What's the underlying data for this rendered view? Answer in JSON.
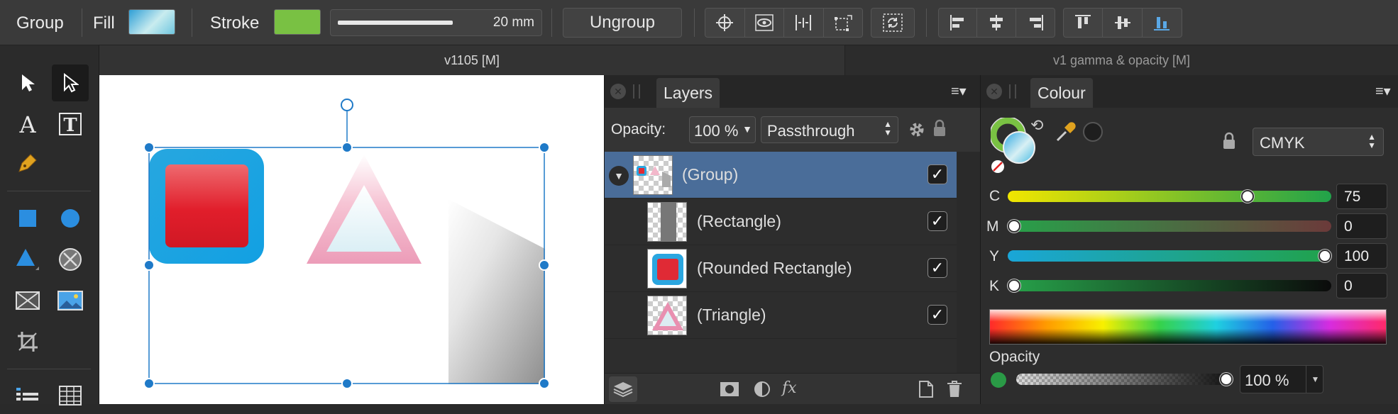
{
  "toolbar": {
    "mode_label": "Group",
    "fill_label": "Fill",
    "stroke_label": "Stroke",
    "stroke_width": "20 mm",
    "stroke_width_level": 0.4,
    "ungroup_label": "Ungroup",
    "fill_colors": [
      "#35a7d9",
      "#d5eef2"
    ],
    "stroke_color": "#79c143"
  },
  "tabs": [
    {
      "label": "v1105  [M]",
      "active": true
    },
    {
      "label": "v1 gamma & opacity [M]",
      "active": false
    }
  ],
  "tools": [
    "move-tool",
    "node-tool",
    "artistic-text-tool",
    "frame-text-tool",
    "pen-tool",
    "rectangle-tool",
    "ellipse-tool",
    "triangle-tool",
    "donut-tool",
    "picture-frame-tool",
    "image-tool",
    "crop-tool",
    "table-tool"
  ],
  "layers": {
    "tab_label": "Layers",
    "opacity_label": "Opacity:",
    "opacity_value": "100 %",
    "blend_mode": "Passthrough",
    "items": [
      {
        "name": "(Group)",
        "selected": true,
        "visible": true
      },
      {
        "name": "(Rectangle)",
        "selected": false,
        "visible": true
      },
      {
        "name": "(Rounded Rectangle)",
        "selected": false,
        "visible": true
      },
      {
        "name": "(Triangle)",
        "selected": false,
        "visible": true
      }
    ]
  },
  "colour": {
    "tab_label": "Colour",
    "model": "CMYK",
    "opacity_label": "Opacity",
    "opacity_value": "100 %",
    "channels": [
      {
        "label": "C",
        "value": "75",
        "level": 0.75
      },
      {
        "label": "M",
        "value": "0",
        "level": 0
      },
      {
        "label": "Y",
        "value": "100",
        "level": 1.0
      },
      {
        "label": "K",
        "value": "0",
        "level": 0
      }
    ],
    "accent": "#2a9a46"
  }
}
